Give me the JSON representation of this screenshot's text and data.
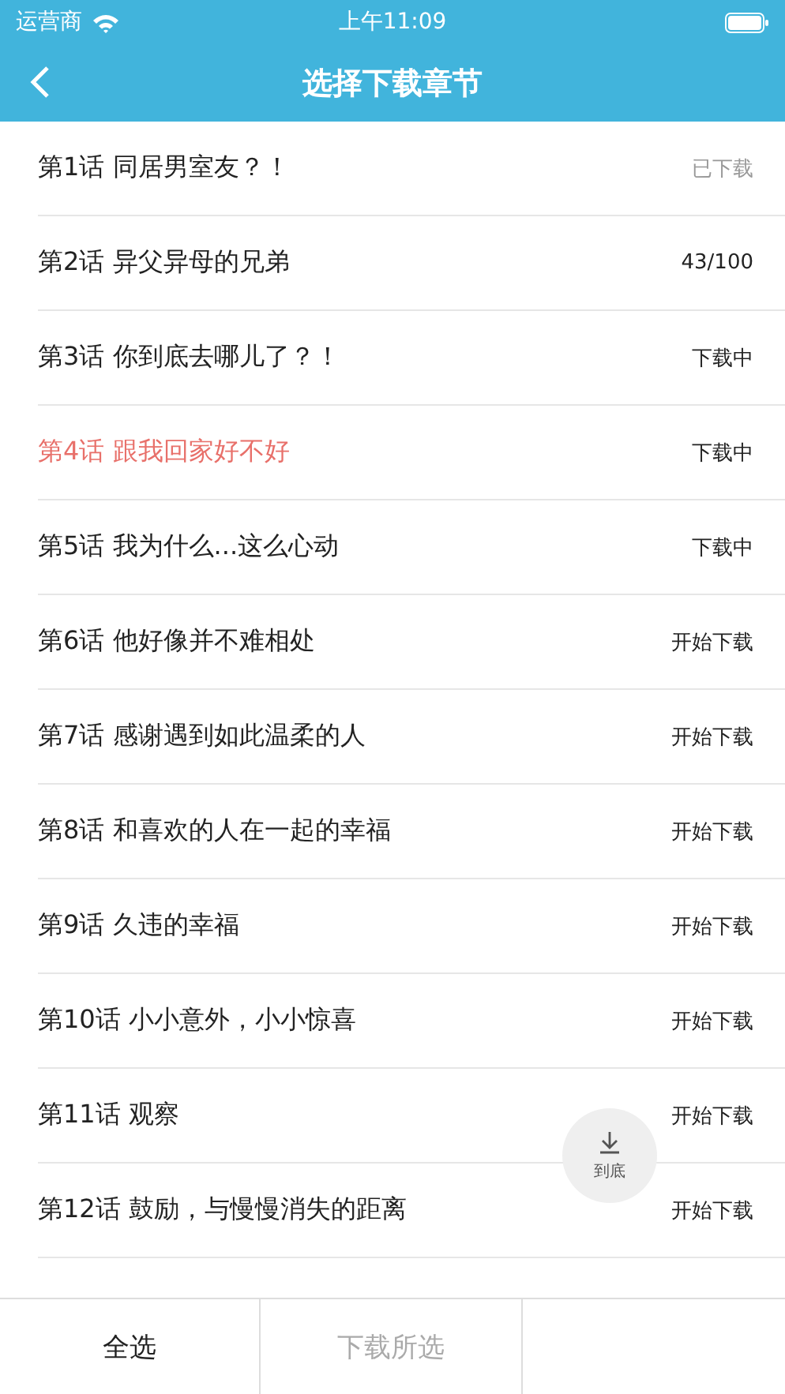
{
  "status_bar": {
    "carrier": "运营商",
    "time": "上午11:09"
  },
  "nav": {
    "title": "选择下载章节"
  },
  "chapters": [
    {
      "title": "第1话 同居男室友？！",
      "status": "已下载",
      "downloaded": true,
      "selected": false
    },
    {
      "title": "第2话 异父异母的兄弟",
      "status": "43/100",
      "downloaded": false,
      "selected": false
    },
    {
      "title": "第3话 你到底去哪儿了？！",
      "status": "下载中",
      "downloaded": false,
      "selected": false
    },
    {
      "title": "第4话 跟我回家好不好",
      "status": "下载中",
      "downloaded": false,
      "selected": true
    },
    {
      "title": "第5话 我为什么...这么心动",
      "status": "下载中",
      "downloaded": false,
      "selected": false
    },
    {
      "title": "第6话 他好像并不难相处",
      "status": "开始下载",
      "downloaded": false,
      "selected": false
    },
    {
      "title": "第7话 感谢遇到如此温柔的人",
      "status": "开始下载",
      "downloaded": false,
      "selected": false
    },
    {
      "title": "第8话 和喜欢的人在一起的幸福",
      "status": "开始下载",
      "downloaded": false,
      "selected": false
    },
    {
      "title": "第9话 久违的幸福",
      "status": "开始下载",
      "downloaded": false,
      "selected": false
    },
    {
      "title": "第10话 小小意外，小小惊喜",
      "status": "开始下载",
      "downloaded": false,
      "selected": false
    },
    {
      "title": "第11话 观察",
      "status": "开始下载",
      "downloaded": false,
      "selected": false
    },
    {
      "title": "第12话 鼓励，与慢慢消失的距离",
      "status": "开始下载",
      "downloaded": false,
      "selected": false
    }
  ],
  "scroll_bottom_button": {
    "label": "到底"
  },
  "bottom_bar": [
    {
      "label": "全选",
      "disabled": false
    },
    {
      "label": "下载所选",
      "disabled": true
    }
  ]
}
